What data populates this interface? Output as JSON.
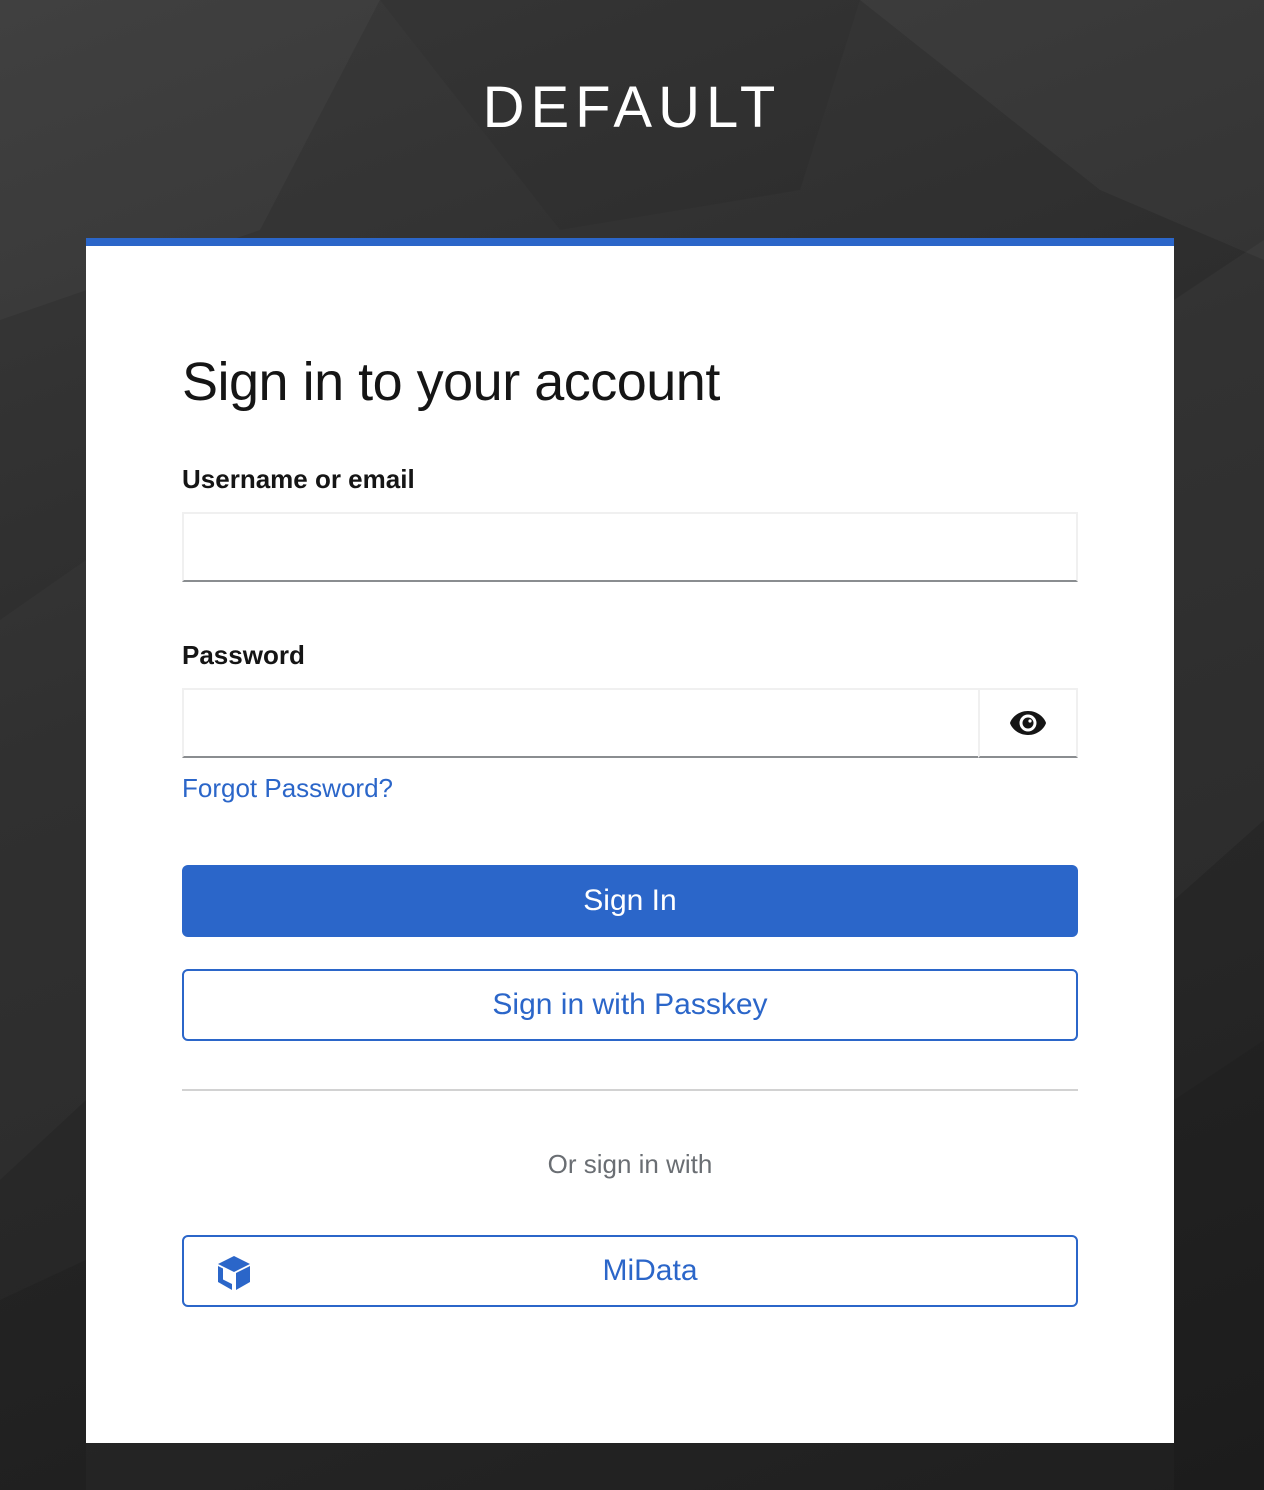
{
  "realm": {
    "title": "DEFAULT"
  },
  "login": {
    "heading": "Sign in to your account",
    "username_label": "Username or email",
    "username_value": "",
    "password_label": "Password",
    "password_value": "",
    "show_password_icon": "eye-icon",
    "forgot_password": "Forgot Password?",
    "sign_in_button": "Sign In",
    "passkey_button": "Sign in with Passkey",
    "or_sign_in_with": "Or sign in with",
    "providers": [
      {
        "label": "MiData",
        "icon": "cube-icon"
      }
    ]
  },
  "colors": {
    "primary": "#2b66c9",
    "heading_text": "#151515",
    "muted_text": "#6a6e73",
    "background": "#2c2c2c"
  }
}
